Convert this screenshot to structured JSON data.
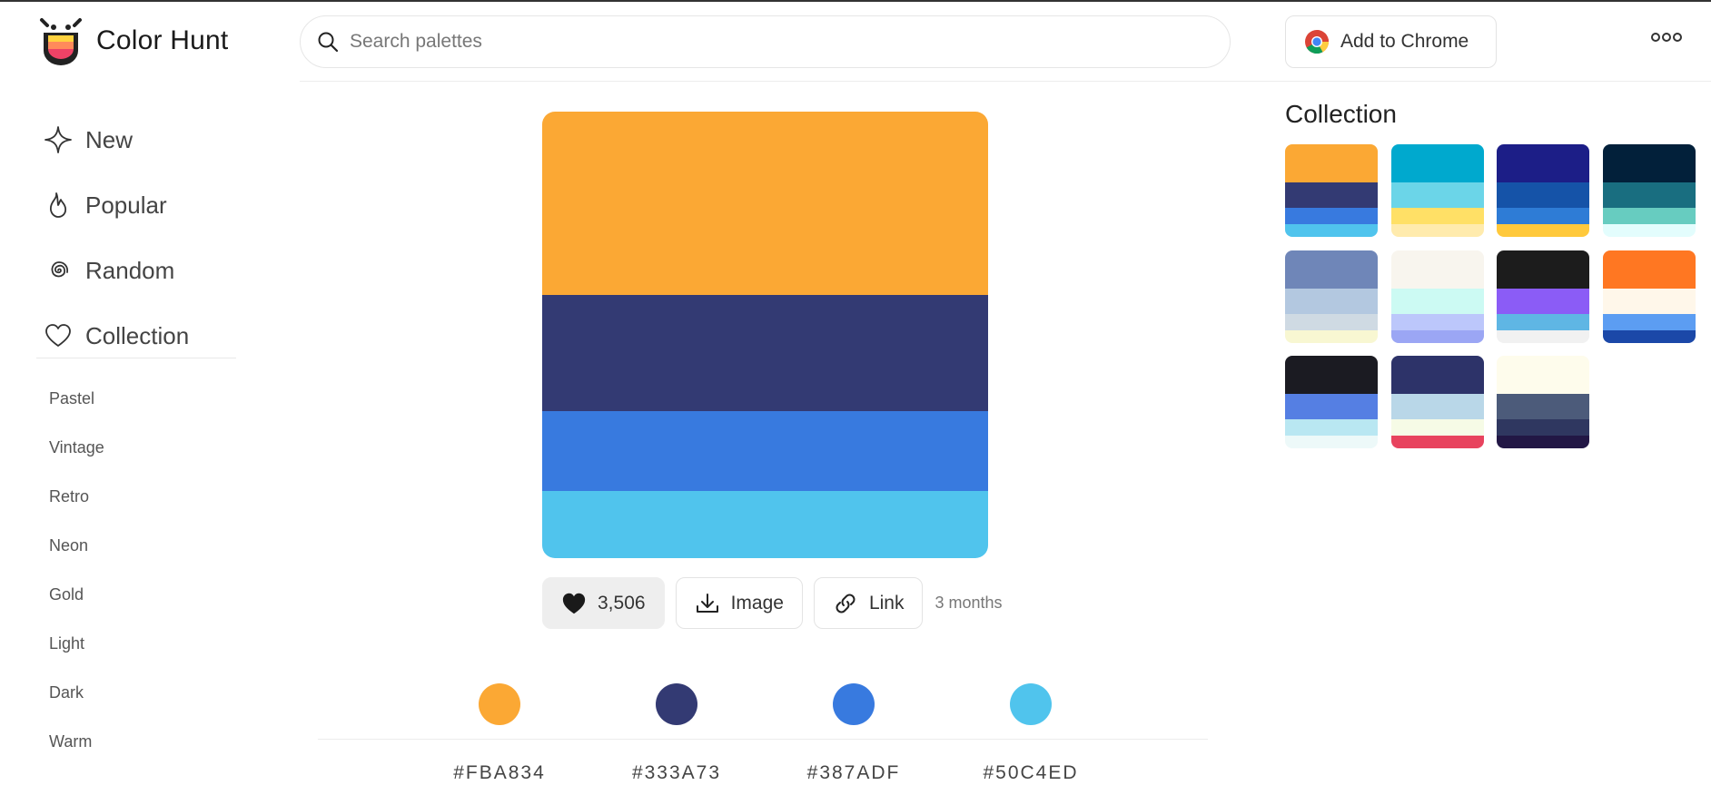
{
  "header": {
    "logo_text": "Color Hunt",
    "search_placeholder": "Search palettes",
    "chrome_button": "Add to Chrome"
  },
  "nav": [
    {
      "label": "New",
      "icon": "sparkle-icon"
    },
    {
      "label": "Popular",
      "icon": "flame-icon"
    },
    {
      "label": "Random",
      "icon": "spiral-icon"
    },
    {
      "label": "Collection",
      "icon": "heart-outline-icon"
    }
  ],
  "tags": [
    "Pastel",
    "Vintage",
    "Retro",
    "Neon",
    "Gold",
    "Light",
    "Dark",
    "Warm"
  ],
  "palette": {
    "colors": [
      "#FBA834",
      "#333A73",
      "#387ADF",
      "#50C4ED"
    ],
    "likes": "3,506",
    "image_label": "Image",
    "link_label": "Link",
    "age": "3 months",
    "hex_labels": [
      "#FBA834",
      "#333A73",
      "#387ADF",
      "#50C4ED"
    ]
  },
  "collection": {
    "title": "Collection",
    "palettes": [
      [
        "#FBA834",
        "#333A73",
        "#387ADF",
        "#50C4ED"
      ],
      [
        "#00A9CE",
        "#6BD5E8",
        "#FFE066",
        "#FFEBAD"
      ],
      [
        "#1C1E87",
        "#1553A8",
        "#2E7CD6",
        "#FFC93C"
      ],
      [
        "#02203A",
        "#196E80",
        "#67CCC0",
        "#E3FDFD"
      ],
      [
        "#6F86B8",
        "#B3C8E0",
        "#CFDAE3",
        "#F8F7D2"
      ],
      [
        "#F8F5EE",
        "#CCFAF3",
        "#BCC7FB",
        "#9BA6F4"
      ],
      [
        "#1C1C1C",
        "#8B5CF6",
        "#5FB6E4",
        "#F1F1F1"
      ],
      [
        "#FF7722",
        "#FFF7EA",
        "#5C9DF2",
        "#1B48A8"
      ],
      [
        "#1B1B22",
        "#557FE3",
        "#B9E7F2",
        "#EDF9F9"
      ],
      [
        "#2D3369",
        "#B9D7E8",
        "#F6FBE6",
        "#E8435E"
      ],
      [
        "#FEFCEC",
        "#4C5B7A",
        "#2F3760",
        "#221745"
      ]
    ]
  }
}
